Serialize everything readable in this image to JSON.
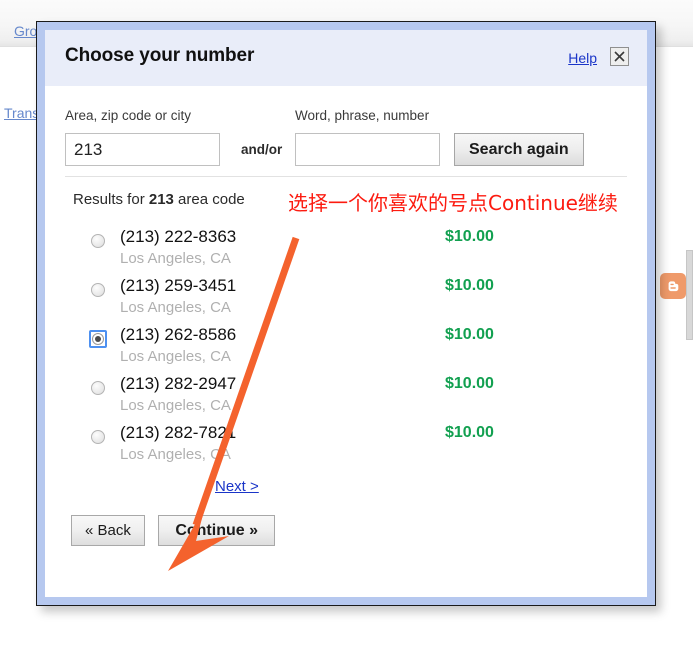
{
  "background": {
    "links": [
      {
        "name": "groups-link",
        "label": "Gro"
      },
      {
        "name": "translate-link",
        "label": "Trans"
      }
    ],
    "blogger_icon": "blogger-icon"
  },
  "dialog": {
    "title": "Choose your number",
    "help_label": "Help",
    "close_icon": "close-icon",
    "search": {
      "area_label": "Area, zip code or city",
      "area_value": "213",
      "area_placeholder": "",
      "andor_label": "and/or",
      "word_label": "Word, phrase, number",
      "word_value": "",
      "word_placeholder": "",
      "search_button_label": "Search again"
    },
    "results": {
      "header_prefix": "Results for ",
      "header_term": "213",
      "header_suffix": " area code",
      "items": [
        {
          "number": "(213) 222-8363",
          "city": "Los Angeles, CA",
          "price": "$10.00",
          "selected": false
        },
        {
          "number": "(213) 259-3451",
          "city": "Los Angeles, CA",
          "price": "$10.00",
          "selected": false
        },
        {
          "number": "(213) 262-8586",
          "city": "Los Angeles, CA",
          "price": "$10.00",
          "selected": true
        },
        {
          "number": "(213) 282-2947",
          "city": "Los Angeles, CA",
          "price": "$10.00",
          "selected": false
        },
        {
          "number": "(213) 282-7821",
          "city": "Los Angeles, CA",
          "price": "$10.00",
          "selected": false
        }
      ],
      "next_label": "Next >"
    },
    "footer": {
      "back_label": "« Back",
      "continue_label": "Continue »"
    }
  },
  "annotation": {
    "text": "选择一个你喜欢的号点Continue继续",
    "color": "#fc1b10",
    "arrow_color": "#f4622d",
    "arrow_name": "annotation-arrow"
  },
  "colors": {
    "dialog_border": "#b6c8ef",
    "header_bg": "#e9edf9",
    "link": "#1a35c8",
    "price_green": "#12a050",
    "radio_focus": "#4d90f0"
  }
}
